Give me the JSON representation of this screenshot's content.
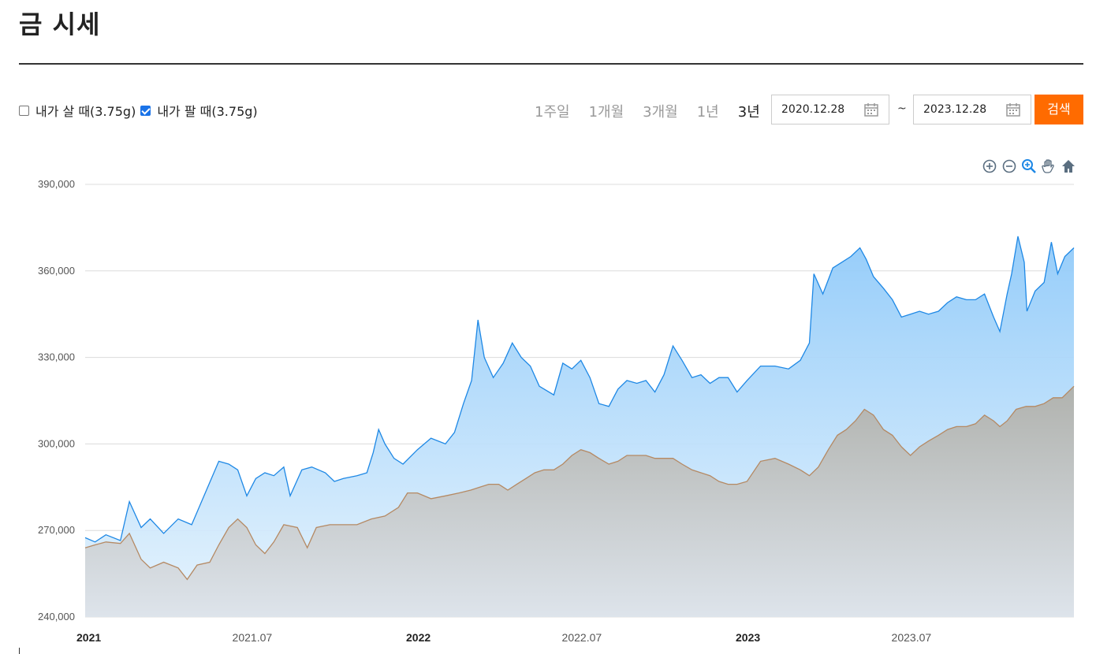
{
  "page": {
    "title": "금 시세"
  },
  "filters": {
    "buy_label": "내가 살 때(3.75g)",
    "buy_checked": false,
    "sell_label": "내가 팔 때(3.75g)",
    "sell_checked": true
  },
  "periods": [
    {
      "label": "1주일",
      "active": false
    },
    {
      "label": "1개월",
      "active": false
    },
    {
      "label": "3개월",
      "active": false
    },
    {
      "label": "1년",
      "active": false
    },
    {
      "label": "3년",
      "active": true
    }
  ],
  "date_range": {
    "start": "2020.12.28",
    "separator": "~",
    "end": "2023.12.28"
  },
  "search_button": "검색",
  "colors": {
    "accent": "#ff6b00",
    "buy_line": "#1e88e5",
    "buy_fill_top": "#90caf9",
    "sell_line": "#b58963",
    "sell_fill": "#b8b8b2",
    "icon": "#5a6e80"
  },
  "toolbar_icons": [
    "zoom-in-icon",
    "zoom-out-icon",
    "zoom-select-icon",
    "pan-hand-icon",
    "home-icon"
  ],
  "chart_data": {
    "type": "area",
    "title": "",
    "xlabel": "",
    "ylabel": "",
    "x_range": [
      "2020-12-28",
      "2023-12-28"
    ],
    "ylim": [
      240000,
      390000
    ],
    "y_ticks": [
      240000,
      270000,
      300000,
      330000,
      360000,
      390000
    ],
    "y_tick_labels": [
      "240,000",
      "270,000",
      "300,000",
      "330,000",
      "360,000",
      "390,000"
    ],
    "x_ticks": [
      {
        "date": "2021-01-01",
        "label": "2021",
        "bold": true
      },
      {
        "date": "2021-07-01",
        "label": "2021.07",
        "bold": false
      },
      {
        "date": "2022-01-01",
        "label": "2022",
        "bold": true
      },
      {
        "date": "2022-07-01",
        "label": "2022.07",
        "bold": false
      },
      {
        "date": "2023-01-01",
        "label": "2023",
        "bold": true
      },
      {
        "date": "2023-07-01",
        "label": "2023.07",
        "bold": false
      }
    ],
    "grid": true,
    "series": [
      {
        "key": "buy",
        "color": "#1e88e5",
        "points": [
          [
            "2020-12-28",
            267500
          ],
          [
            "2021-01-08",
            266000
          ],
          [
            "2021-01-20",
            268500
          ],
          [
            "2021-02-05",
            266500
          ],
          [
            "2021-02-15",
            280000
          ],
          [
            "2021-02-28",
            271000
          ],
          [
            "2021-03-10",
            274000
          ],
          [
            "2021-03-25",
            269000
          ],
          [
            "2021-04-10",
            274000
          ],
          [
            "2021-04-25",
            272000
          ],
          [
            "2021-05-10",
            283000
          ],
          [
            "2021-05-25",
            294000
          ],
          [
            "2021-06-05",
            293000
          ],
          [
            "2021-06-15",
            291000
          ],
          [
            "2021-06-25",
            282000
          ],
          [
            "2021-07-05",
            288000
          ],
          [
            "2021-07-15",
            290000
          ],
          [
            "2021-07-25",
            289000
          ],
          [
            "2021-08-05",
            292000
          ],
          [
            "2021-08-12",
            282000
          ],
          [
            "2021-08-25",
            291000
          ],
          [
            "2021-09-05",
            292000
          ],
          [
            "2021-09-20",
            290000
          ],
          [
            "2021-09-30",
            287000
          ],
          [
            "2021-10-10",
            288000
          ],
          [
            "2021-10-25",
            289000
          ],
          [
            "2021-11-05",
            290000
          ],
          [
            "2021-11-12",
            297000
          ],
          [
            "2021-11-18",
            305000
          ],
          [
            "2021-11-25",
            300000
          ],
          [
            "2021-12-05",
            295000
          ],
          [
            "2021-12-15",
            293000
          ],
          [
            "2021-12-31",
            298000
          ],
          [
            "2022-01-15",
            302000
          ],
          [
            "2022-01-31",
            300000
          ],
          [
            "2022-02-10",
            304000
          ],
          [
            "2022-02-20",
            314000
          ],
          [
            "2022-03-01",
            322000
          ],
          [
            "2022-03-08",
            343000
          ],
          [
            "2022-03-15",
            330000
          ],
          [
            "2022-03-25",
            323000
          ],
          [
            "2022-04-05",
            328000
          ],
          [
            "2022-04-15",
            335000
          ],
          [
            "2022-04-25",
            330000
          ],
          [
            "2022-05-05",
            327000
          ],
          [
            "2022-05-15",
            320000
          ],
          [
            "2022-05-31",
            317000
          ],
          [
            "2022-06-10",
            328000
          ],
          [
            "2022-06-20",
            326000
          ],
          [
            "2022-06-30",
            329000
          ],
          [
            "2022-07-10",
            323000
          ],
          [
            "2022-07-20",
            314000
          ],
          [
            "2022-07-31",
            313000
          ],
          [
            "2022-08-10",
            319000
          ],
          [
            "2022-08-20",
            322000
          ],
          [
            "2022-08-31",
            321000
          ],
          [
            "2022-09-10",
            322000
          ],
          [
            "2022-09-20",
            318000
          ],
          [
            "2022-09-30",
            324000
          ],
          [
            "2022-10-10",
            334000
          ],
          [
            "2022-10-20",
            329000
          ],
          [
            "2022-10-31",
            323000
          ],
          [
            "2022-11-10",
            324000
          ],
          [
            "2022-11-20",
            321000
          ],
          [
            "2022-11-30",
            323000
          ],
          [
            "2022-12-10",
            323000
          ],
          [
            "2022-12-20",
            318000
          ],
          [
            "2022-12-31",
            322000
          ],
          [
            "2023-01-15",
            327000
          ],
          [
            "2023-01-31",
            327000
          ],
          [
            "2023-02-15",
            326000
          ],
          [
            "2023-02-28",
            329000
          ],
          [
            "2023-03-10",
            335000
          ],
          [
            "2023-03-15",
            359000
          ],
          [
            "2023-03-25",
            352000
          ],
          [
            "2023-04-05",
            361000
          ],
          [
            "2023-04-15",
            363000
          ],
          [
            "2023-04-25",
            365000
          ],
          [
            "2023-05-05",
            368000
          ],
          [
            "2023-05-12",
            364000
          ],
          [
            "2023-05-20",
            358000
          ],
          [
            "2023-05-31",
            354000
          ],
          [
            "2023-06-10",
            350000
          ],
          [
            "2023-06-20",
            344000
          ],
          [
            "2023-06-30",
            345000
          ],
          [
            "2023-07-10",
            346000
          ],
          [
            "2023-07-20",
            345000
          ],
          [
            "2023-07-31",
            346000
          ],
          [
            "2023-08-10",
            349000
          ],
          [
            "2023-08-20",
            351000
          ],
          [
            "2023-08-31",
            350000
          ],
          [
            "2023-09-10",
            350000
          ],
          [
            "2023-09-20",
            352000
          ],
          [
            "2023-09-30",
            344000
          ],
          [
            "2023-10-07",
            339000
          ],
          [
            "2023-10-15",
            352000
          ],
          [
            "2023-10-20",
            359000
          ],
          [
            "2023-10-27",
            372000
          ],
          [
            "2023-11-03",
            363000
          ],
          [
            "2023-11-06",
            346000
          ],
          [
            "2023-11-15",
            353000
          ],
          [
            "2023-11-25",
            356000
          ],
          [
            "2023-12-03",
            370000
          ],
          [
            "2023-12-10",
            359000
          ],
          [
            "2023-12-18",
            365000
          ],
          [
            "2023-12-28",
            368000
          ]
        ]
      },
      {
        "key": "sell",
        "color": "#b58963",
        "points": [
          [
            "2020-12-28",
            264000
          ],
          [
            "2021-01-08",
            265000
          ],
          [
            "2021-01-20",
            266000
          ],
          [
            "2021-02-05",
            265500
          ],
          [
            "2021-02-15",
            269000
          ],
          [
            "2021-02-28",
            260000
          ],
          [
            "2021-03-10",
            257000
          ],
          [
            "2021-03-25",
            259000
          ],
          [
            "2021-04-10",
            257000
          ],
          [
            "2021-04-20",
            253000
          ],
          [
            "2021-05-01",
            258000
          ],
          [
            "2021-05-15",
            259000
          ],
          [
            "2021-05-25",
            265000
          ],
          [
            "2021-06-05",
            271000
          ],
          [
            "2021-06-15",
            274000
          ],
          [
            "2021-06-25",
            271000
          ],
          [
            "2021-07-05",
            265000
          ],
          [
            "2021-07-15",
            262000
          ],
          [
            "2021-07-25",
            266000
          ],
          [
            "2021-08-05",
            272000
          ],
          [
            "2021-08-20",
            271000
          ],
          [
            "2021-08-31",
            264000
          ],
          [
            "2021-09-10",
            271000
          ],
          [
            "2021-09-25",
            272000
          ],
          [
            "2021-10-10",
            272000
          ],
          [
            "2021-10-25",
            272000
          ],
          [
            "2021-11-10",
            274000
          ],
          [
            "2021-11-25",
            275000
          ],
          [
            "2021-12-10",
            278000
          ],
          [
            "2021-12-20",
            283000
          ],
          [
            "2021-12-31",
            283000
          ],
          [
            "2022-01-15",
            281000
          ],
          [
            "2022-01-31",
            282000
          ],
          [
            "2022-02-15",
            283000
          ],
          [
            "2022-02-28",
            284000
          ],
          [
            "2022-03-10",
            285000
          ],
          [
            "2022-03-20",
            286000
          ],
          [
            "2022-03-31",
            286000
          ],
          [
            "2022-04-10",
            284000
          ],
          [
            "2022-04-20",
            286000
          ],
          [
            "2022-04-30",
            288000
          ],
          [
            "2022-05-10",
            290000
          ],
          [
            "2022-05-20",
            291000
          ],
          [
            "2022-05-31",
            291000
          ],
          [
            "2022-06-10",
            293000
          ],
          [
            "2022-06-20",
            296000
          ],
          [
            "2022-06-30",
            298000
          ],
          [
            "2022-07-10",
            297000
          ],
          [
            "2022-07-20",
            295000
          ],
          [
            "2022-07-31",
            293000
          ],
          [
            "2022-08-10",
            294000
          ],
          [
            "2022-08-20",
            296000
          ],
          [
            "2022-08-31",
            296000
          ],
          [
            "2022-09-10",
            296000
          ],
          [
            "2022-09-20",
            295000
          ],
          [
            "2022-09-30",
            295000
          ],
          [
            "2022-10-10",
            295000
          ],
          [
            "2022-10-20",
            293000
          ],
          [
            "2022-10-31",
            291000
          ],
          [
            "2022-11-10",
            290000
          ],
          [
            "2022-11-20",
            289000
          ],
          [
            "2022-11-30",
            287000
          ],
          [
            "2022-12-10",
            286000
          ],
          [
            "2022-12-20",
            286000
          ],
          [
            "2022-12-31",
            287000
          ],
          [
            "2023-01-15",
            294000
          ],
          [
            "2023-01-31",
            295000
          ],
          [
            "2023-02-15",
            293000
          ],
          [
            "2023-02-28",
            291000
          ],
          [
            "2023-03-10",
            289000
          ],
          [
            "2023-03-20",
            292000
          ],
          [
            "2023-03-31",
            298000
          ],
          [
            "2023-04-10",
            303000
          ],
          [
            "2023-04-20",
            305000
          ],
          [
            "2023-04-30",
            308000
          ],
          [
            "2023-05-10",
            312000
          ],
          [
            "2023-05-20",
            310000
          ],
          [
            "2023-05-31",
            305000
          ],
          [
            "2023-06-10",
            303000
          ],
          [
            "2023-06-20",
            299000
          ],
          [
            "2023-06-30",
            296000
          ],
          [
            "2023-07-10",
            299000
          ],
          [
            "2023-07-20",
            301000
          ],
          [
            "2023-07-31",
            303000
          ],
          [
            "2023-08-10",
            305000
          ],
          [
            "2023-08-20",
            306000
          ],
          [
            "2023-08-31",
            306000
          ],
          [
            "2023-09-10",
            307000
          ],
          [
            "2023-09-20",
            310000
          ],
          [
            "2023-09-30",
            308000
          ],
          [
            "2023-10-07",
            306000
          ],
          [
            "2023-10-15",
            308000
          ],
          [
            "2023-10-25",
            312000
          ],
          [
            "2023-11-05",
            313000
          ],
          [
            "2023-11-15",
            313000
          ],
          [
            "2023-11-25",
            314000
          ],
          [
            "2023-12-05",
            316000
          ],
          [
            "2023-12-15",
            316000
          ],
          [
            "2023-12-28",
            320000
          ]
        ]
      }
    ]
  }
}
